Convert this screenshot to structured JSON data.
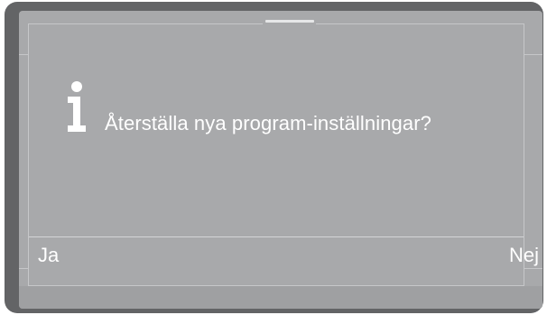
{
  "dialog": {
    "icon": "info-icon",
    "message": "Återställa nya program-inställningar?",
    "buttons": {
      "yes_label": "Ja",
      "no_label": "Nej"
    }
  },
  "colors": {
    "screen_background": "#a8a9ab",
    "device_frame": "#636466",
    "text": "#ffffff"
  }
}
